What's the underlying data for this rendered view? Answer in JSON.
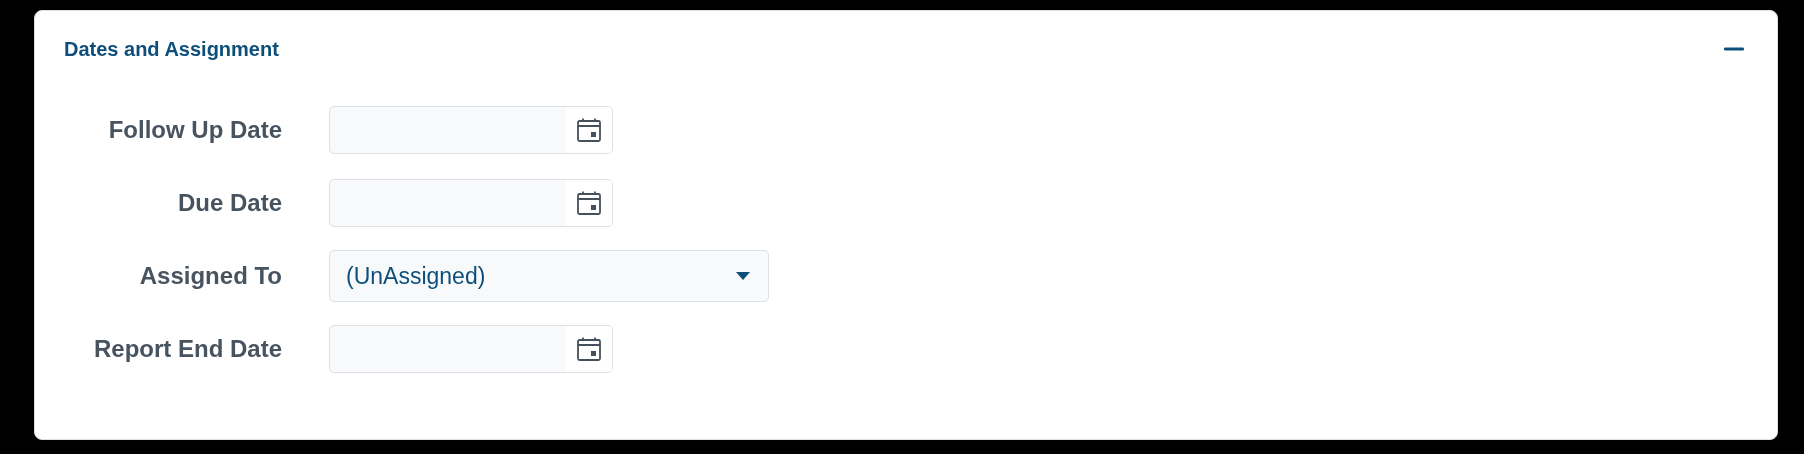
{
  "section": {
    "title": "Dates and Assignment",
    "expanded": true
  },
  "fields": [
    {
      "label": "Follow Up Date",
      "kind": "date"
    },
    {
      "label": "Due Date",
      "kind": "date"
    },
    {
      "label": "Assigned To",
      "kind": "select",
      "value": "(UnAssigned)"
    },
    {
      "label": "Report End Date",
      "kind": "date"
    }
  ]
}
